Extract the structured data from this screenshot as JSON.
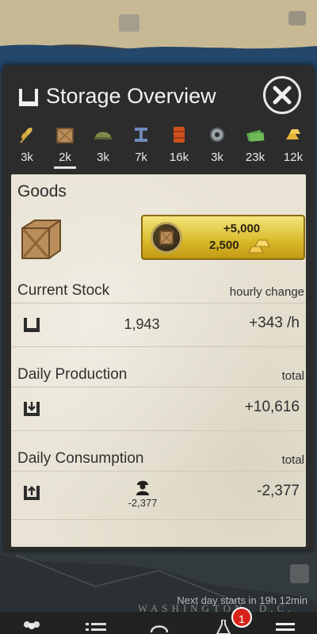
{
  "header": {
    "title": "Storage Overview",
    "close_label": "close"
  },
  "resources": [
    {
      "name": "wheat",
      "count": "3k",
      "icon": "wheat-icon"
    },
    {
      "name": "goods",
      "count": "2k",
      "icon": "crate-icon",
      "active": true
    },
    {
      "name": "helmet",
      "count": "3k",
      "icon": "helmet-icon"
    },
    {
      "name": "steel",
      "count": "7k",
      "icon": "steel-beam-icon"
    },
    {
      "name": "fuel",
      "count": "16k",
      "icon": "oil-barrel-icon"
    },
    {
      "name": "rare",
      "count": "3k",
      "icon": "gear-ore-icon"
    },
    {
      "name": "money",
      "count": "23k",
      "icon": "money-icon"
    },
    {
      "name": "gold",
      "count": "12k",
      "icon": "gold-bars-icon"
    }
  ],
  "goods": {
    "title": "Goods",
    "buy_amount": "+5,000",
    "buy_cost": "2,500"
  },
  "current_stock": {
    "label": "Current Stock",
    "right_label": "hourly change",
    "value": "1,943",
    "change": "+343 /h"
  },
  "daily_production": {
    "label": "Daily Production",
    "right_label": "total",
    "total": "+10,616"
  },
  "daily_consumption": {
    "label": "Daily Consumption",
    "right_label": "total",
    "consumer_value": "-2,377",
    "total": "-2,377"
  },
  "map": {
    "next_day": "Next day starts in 19h 12min",
    "city_label": "WASHINGTON, D.C."
  },
  "nav": {
    "badge_count": "1"
  },
  "colors": {
    "accent_gold": "#d8b92a",
    "panel_bg": "#2c2c2c",
    "paper_bg": "#e8e3d4",
    "badge_red": "#d8231b"
  }
}
